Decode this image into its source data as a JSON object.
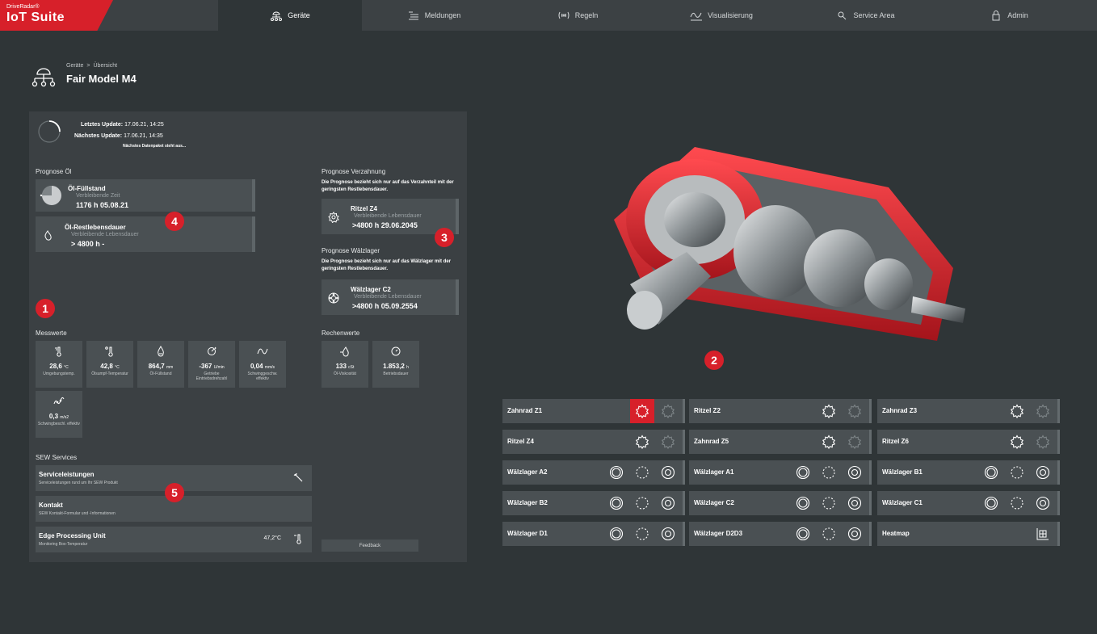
{
  "app": {
    "brand_small": "DriveRadar®",
    "brand": "IoT Suite"
  },
  "nav": [
    {
      "label": "Geräte",
      "icon": "devices-icon",
      "active": true
    },
    {
      "label": "Meldungen",
      "icon": "messages-icon"
    },
    {
      "label": "Regeln",
      "icon": "rules-icon"
    },
    {
      "label": "Visualisierung",
      "icon": "visualization-icon"
    },
    {
      "label": "Service Area",
      "icon": "service-icon"
    },
    {
      "label": "Admin",
      "icon": "lock-icon"
    }
  ],
  "header": {
    "breadcrumb": [
      "Geräte",
      "Übersicht"
    ],
    "separator": ">",
    "title": "Fair Model M4"
  },
  "update": {
    "last_label": "Letztes Update:",
    "last_value": "17.06.21, 14:25",
    "next_label": "Nächstes Update:",
    "next_value": "17.06.21, 14:35",
    "status": "Nächstes Datenpaket steht aus..."
  },
  "prognose_oel": {
    "label": "Prognose Öl",
    "cards": [
      {
        "title": "Öl-Füllstand",
        "sub": "Verbleibende Zeit",
        "value": "1176 h 05.08.21"
      },
      {
        "title": "Öl-Restlebensdauer",
        "sub": "Verbleibende Lebensdauer",
        "value": "> 4800 h   -"
      }
    ]
  },
  "prognose_verzahnung": {
    "label": "Prognose Verzahnung",
    "note": "Die Prognose bezieht sich nur auf das Verzahnteil mit der geringsten Restlebensdauer.",
    "card": {
      "title": "Ritzel Z4",
      "sub": "Verbleibende Lebensdauer",
      "value": ">4800 h   29.06.2045"
    }
  },
  "prognose_waelzlager": {
    "label": "Prognose Wälzlager",
    "note": "Die Prognose bezieht sich nur auf das Wälzlager mit der geringsten Restlebensdauer.",
    "card": {
      "title": "Wälzlager C2",
      "sub": "Verbleibende Lebensdauer",
      "value": ">4800 h   05.09.2554"
    }
  },
  "messwerte": {
    "label": "Messwerte",
    "tiles": [
      {
        "value": "28,6",
        "unit": "°C",
        "label": "Umgebungstemp."
      },
      {
        "value": "42,8",
        "unit": "°C",
        "label": "Ölsumpf-Temperatur"
      },
      {
        "value": "864,7",
        "unit": "mm",
        "label": "Öl-Füllstand"
      },
      {
        "value": "-367",
        "unit": "U/min",
        "label": "Getriebe Eintriebsdrehzahl"
      },
      {
        "value": "0,04",
        "unit": "mm/s",
        "label": "Schwinggeschw. effektiv"
      },
      {
        "value": "0,3",
        "unit": "m/s2",
        "label": "Schwingbeschl. effektiv"
      }
    ]
  },
  "rechenwerte": {
    "label": "Rechenwerte",
    "tiles": [
      {
        "value": "133",
        "unit": "cSt",
        "label": "Öl-Viskosität"
      },
      {
        "value": "1.853,2",
        "unit": "h",
        "label": "Betriebsdauer"
      }
    ]
  },
  "services": {
    "label": "SEW Services",
    "items": [
      {
        "title": "Serviceleistungen",
        "sub": "Serviceleistungen rund um Ihr SEW Produkt"
      },
      {
        "title": "Kontakt",
        "sub": "SEW Kontakt-Formular und -Informationen"
      },
      {
        "title": "Edge Processing Unit",
        "sub": "Monitoring Box-Temperatur",
        "value": "47,2°C"
      }
    ]
  },
  "feedback": "Feedback",
  "badges": [
    "1",
    "2",
    "3",
    "4",
    "5"
  ],
  "components": [
    {
      "name": "Zahnrad Z1",
      "type": "gear",
      "alert": true
    },
    {
      "name": "Ritzel Z2",
      "type": "gear"
    },
    {
      "name": "Zahnrad Z3",
      "type": "gear"
    },
    {
      "name": "Ritzel Z4",
      "type": "gear"
    },
    {
      "name": "Zahnrad Z5",
      "type": "gear"
    },
    {
      "name": "Ritzel Z6",
      "type": "gear"
    },
    {
      "name": "Wälzlager A2",
      "type": "bearing"
    },
    {
      "name": "Wälzlager A1",
      "type": "bearing"
    },
    {
      "name": "Wälzlager B1",
      "type": "bearing"
    },
    {
      "name": "Wälzlager B2",
      "type": "bearing"
    },
    {
      "name": "Wälzlager C2",
      "type": "bearing"
    },
    {
      "name": "Wälzlager C1",
      "type": "bearing"
    },
    {
      "name": "Wälzlager D1",
      "type": "bearing"
    },
    {
      "name": "Wälzlager D2D3",
      "type": "bearing"
    },
    {
      "name": "Heatmap",
      "type": "heatmap"
    }
  ],
  "colors": {
    "accent": "#d7202a",
    "bg": "#2f3537",
    "panel": "#3b4043",
    "card": "#4a5053"
  }
}
